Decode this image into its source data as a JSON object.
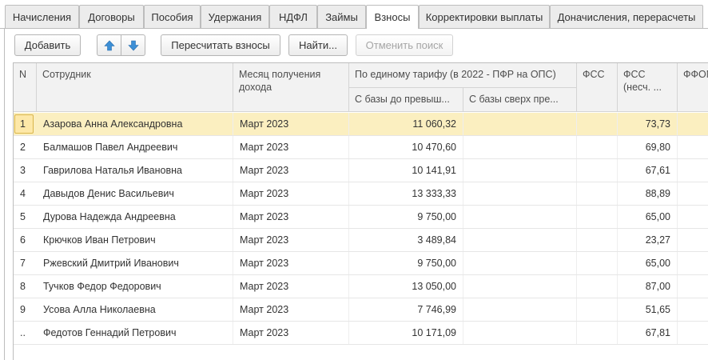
{
  "tabs": [
    {
      "label": "Начисления"
    },
    {
      "label": "Договоры"
    },
    {
      "label": "Пособия"
    },
    {
      "label": "Удержания"
    },
    {
      "label": "НДФЛ"
    },
    {
      "label": "Займы"
    },
    {
      "label": "Взносы"
    },
    {
      "label": "Корректировки выплаты"
    },
    {
      "label": "Доначисления, перерасчеты"
    }
  ],
  "toolbar": {
    "add_label": "Добавить",
    "recalc_label": "Пересчитать взносы",
    "find_label": "Найти...",
    "cancel_search_label": "Отменить поиск",
    "move_up_icon": "arrow-up-icon",
    "move_down_icon": "arrow-down-icon"
  },
  "table": {
    "headers": {
      "n": "N",
      "employee": "Сотрудник",
      "month": "Месяц получения дохода",
      "single_tariff": "По единому тарифу (в 2022 - ПФР на ОПС)",
      "base_below": "С базы до превыш...",
      "base_above": "С базы сверх пре...",
      "fss": "ФСС",
      "fss_ns": "ФСС (несч. ...",
      "ffoms": "ФФОМ"
    },
    "rows": [
      {
        "n": "1",
        "employee": "Азарова Анна Александровна",
        "month": "Март 2023",
        "base_below": "11 060,32",
        "base_above": "",
        "fss": "",
        "fss_ns": "73,73",
        "ffoms": ""
      },
      {
        "n": "2",
        "employee": "Балмашов Павел Андреевич",
        "month": "Март 2023",
        "base_below": "10 470,60",
        "base_above": "",
        "fss": "",
        "fss_ns": "69,80",
        "ffoms": ""
      },
      {
        "n": "3",
        "employee": "Гаврилова Наталья Ивановна",
        "month": "Март 2023",
        "base_below": "10 141,91",
        "base_above": "",
        "fss": "",
        "fss_ns": "67,61",
        "ffoms": ""
      },
      {
        "n": "4",
        "employee": "Давыдов Денис Васильевич",
        "month": "Март 2023",
        "base_below": "13 333,33",
        "base_above": "",
        "fss": "",
        "fss_ns": "88,89",
        "ffoms": ""
      },
      {
        "n": "5",
        "employee": "Дурова Надежда Андреевна",
        "month": "Март 2023",
        "base_below": "9 750,00",
        "base_above": "",
        "fss": "",
        "fss_ns": "65,00",
        "ffoms": ""
      },
      {
        "n": "6",
        "employee": "Крючков Иван Петрович",
        "month": "Март 2023",
        "base_below": "3 489,84",
        "base_above": "",
        "fss": "",
        "fss_ns": "23,27",
        "ffoms": ""
      },
      {
        "n": "7",
        "employee": "Ржевский Дмитрий Иванович",
        "month": "Март 2023",
        "base_below": "9 750,00",
        "base_above": "",
        "fss": "",
        "fss_ns": "65,00",
        "ffoms": ""
      },
      {
        "n": "8",
        "employee": "Тучков Федор Федорович",
        "month": "Март 2023",
        "base_below": "13 050,00",
        "base_above": "",
        "fss": "",
        "fss_ns": "87,00",
        "ffoms": ""
      },
      {
        "n": "9",
        "employee": "Усова Алла Николаевна",
        "month": "Март 2023",
        "base_below": "7 746,99",
        "base_above": "",
        "fss": "",
        "fss_ns": "51,65",
        "ffoms": ""
      },
      {
        "n": "..",
        "employee": "Федотов Геннадий Петрович",
        "month": "Март 2023",
        "base_below": "10 171,09",
        "base_above": "",
        "fss": "",
        "fss_ns": "67,81",
        "ffoms": ""
      }
    ]
  },
  "colors": {
    "selected_row": "#fbefc0",
    "header_bg": "#f2f2f2",
    "arrow_icon": "#3c8fd6"
  }
}
